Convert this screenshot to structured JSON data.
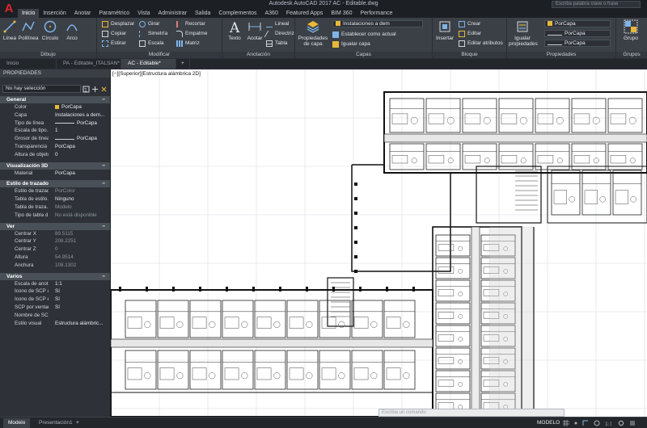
{
  "app": {
    "window_title": "Autodesk AutoCAD 2017   AC - Editable.dwg",
    "help_search_placeholder": "Escriba palabra clave o frase",
    "logo_letter": "A"
  },
  "ribbon_tabs": [
    "Inicio",
    "Inserción",
    "Anotar",
    "Paramétrico",
    "Vista",
    "Administrar",
    "Salida",
    "Complementos",
    "A360",
    "Featured Apps",
    "BIM 360",
    "Performance"
  ],
  "ribbon": {
    "draw": {
      "title": "Dibujo",
      "buttons": [
        "Línea",
        "Polilínea",
        "Círculo",
        "Arco"
      ]
    },
    "modify": {
      "title": "Modificar",
      "buttons": [
        "Desplazar",
        "Girar",
        "Recortar",
        "Copiar",
        "Simetría",
        "Empalme",
        "Estirar",
        "Escala",
        "Matriz"
      ]
    },
    "annotation": {
      "title": "Anotación",
      "buttons": [
        "Texto",
        "Acotar"
      ],
      "small": [
        "Lineal",
        "Directriz",
        "Tabla"
      ]
    },
    "layers": {
      "title": "Capas",
      "props_button": "Propiedades de capa",
      "current_layer": "Instalaciones a dem",
      "buttons": [
        "Establecer como actual",
        "Igualar capa"
      ]
    },
    "block": {
      "title": "Bloque",
      "insert": "Insertar",
      "buttons": [
        "Crear",
        "Editar",
        "Editar atributos"
      ]
    },
    "properties": {
      "title": "Propiedades",
      "match": "Igualar propiedades",
      "color": "PorCapa",
      "linetype": "PorCapa",
      "lineweight": "PorCapa"
    },
    "groups": {
      "title": "Grupos",
      "button": "Grupo"
    }
  },
  "doc_tabs": [
    "Inicio",
    "PA - Editable_ITALSAN*",
    "AC - Editable*"
  ],
  "palette": {
    "title": "PROPIEDADES",
    "selection": "No hay selección",
    "sections": [
      {
        "name": "General",
        "rows": [
          {
            "label": "Color",
            "value": "PorCapa",
            "swatch": true
          },
          {
            "label": "Capa",
            "value": "Instalaciones a dem..."
          },
          {
            "label": "Tipo de línea",
            "value": "PorCapa",
            "line": true
          },
          {
            "label": "Escala de tipo...",
            "value": "1"
          },
          {
            "label": "Grosor de línea",
            "value": "PorCapa",
            "line": true
          },
          {
            "label": "Transparencia",
            "value": "PorCapa"
          },
          {
            "label": "Altura de objeto",
            "value": "0"
          }
        ]
      },
      {
        "name": "Visualización 3D",
        "rows": [
          {
            "label": "Material",
            "value": "PorCapa"
          }
        ]
      },
      {
        "name": "Estilo de trazado",
        "rows": [
          {
            "label": "Estilo de trazado",
            "value": "PorColor",
            "dim": true
          },
          {
            "label": "Tabla de estilo...",
            "value": "Ninguno"
          },
          {
            "label": "Tabla de traza...",
            "value": "Modelo",
            "dim": true
          },
          {
            "label": "Tipo de tabla d...",
            "value": "No está disponible",
            "dim": true
          }
        ]
      },
      {
        "name": "Ver",
        "rows": [
          {
            "label": "Centrar X",
            "value": "89.5115",
            "dim": true
          },
          {
            "label": "Centrar Y",
            "value": "208.2251",
            "dim": true
          },
          {
            "label": "Centrar Z",
            "value": "0",
            "dim": true
          },
          {
            "label": "Altura",
            "value": "54.9514",
            "dim": true
          },
          {
            "label": "Anchura",
            "value": "108.1302",
            "dim": true
          }
        ]
      },
      {
        "name": "Varios",
        "rows": [
          {
            "label": "Escala de anot...",
            "value": "1:1"
          },
          {
            "label": "Icono de SCP a...",
            "value": "Sí"
          },
          {
            "label": "Icono de SCP e...",
            "value": "Sí"
          },
          {
            "label": "SCP por ventana",
            "value": "Sí"
          },
          {
            "label": "Nombre de SCP",
            "value": ""
          },
          {
            "label": "Estilo visual",
            "value": "Estructura alámbric..."
          }
        ]
      }
    ]
  },
  "viewport_label": "[−][Superior][Estructura alámbrica 2D]",
  "command_placeholder": "Escriba un comando",
  "layout_tabs": [
    "Modelo",
    "Presentación1"
  ],
  "status": {
    "space": "MODELO"
  },
  "colors": {
    "ribbon_bg": "#3b4047",
    "accent_yellow": "#e8b83a",
    "brand_red": "#e0242c",
    "canvas_bg": "#ffffff"
  }
}
